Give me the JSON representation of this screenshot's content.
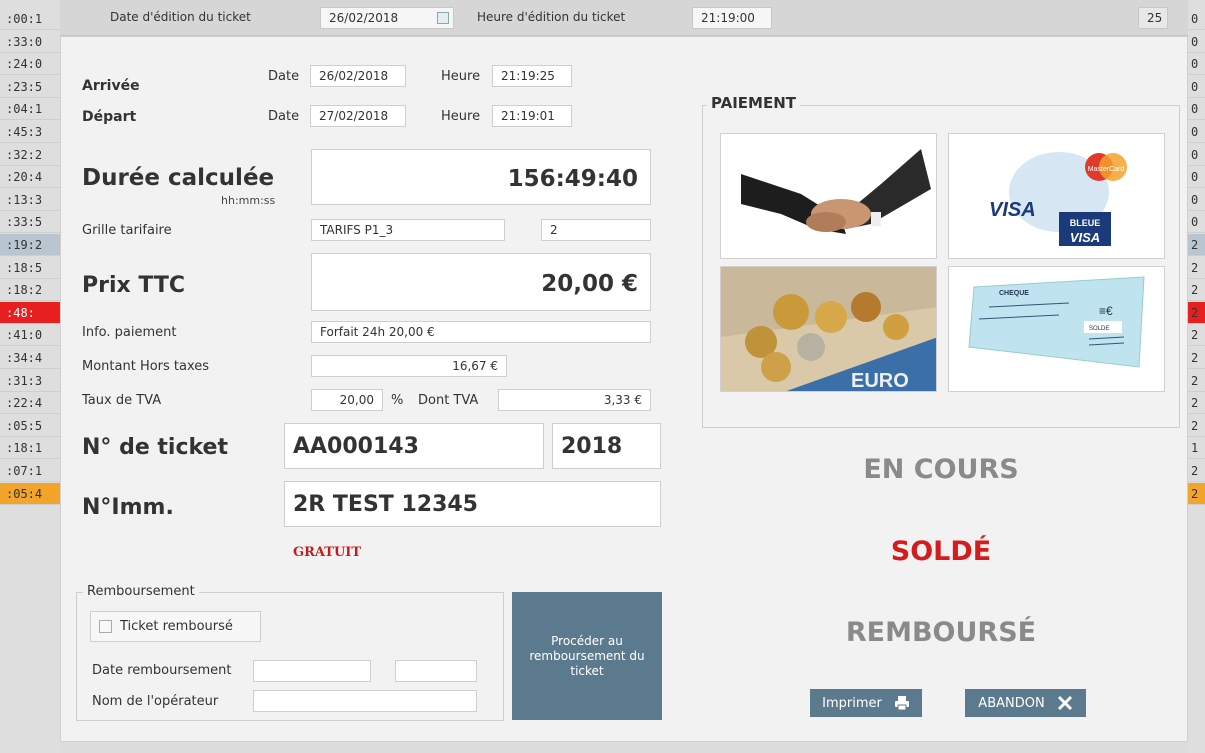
{
  "topbar": {
    "date_label": "Date d'édition du ticket",
    "date_value": "26/02/2018",
    "time_label": "Heure d'édition du ticket",
    "time_value": "21:19:00",
    "right_value": "25"
  },
  "background": {
    "left_times": [
      ":00:1",
      ":33:0",
      ":24:0",
      ":23:5",
      ":04:1",
      ":45:3",
      ":32:2",
      ":20:4",
      ":13:3",
      ":33:5",
      ":19:2",
      ":18:5",
      ":18:2",
      ":48:",
      ":41:0",
      ":34:4",
      ":31:3",
      ":22:4",
      ":05:5",
      ":18:1",
      ":07:1",
      ":05:4"
    ],
    "right_vals": [
      "0",
      "0",
      "0",
      "0",
      "0",
      "0",
      "0",
      "0",
      "0",
      "0",
      "2",
      "2",
      "2",
      "2",
      "2",
      "2",
      "2",
      "2",
      "2",
      "1",
      "2",
      "2"
    ]
  },
  "dialog": {
    "arrivee": {
      "label": "Arrivée",
      "date_label": "Date",
      "date": "26/02/2018",
      "heure_label": "Heure",
      "heure": "21:19:25"
    },
    "depart": {
      "label": "Départ",
      "date_label": "Date",
      "date": "27/02/2018",
      "heure_label": "Heure",
      "heure": "21:19:01"
    },
    "duree": {
      "label": "Durée calculée",
      "unit": "hh:mm:ss",
      "value": "156:49:40"
    },
    "grille": {
      "label": "Grille tarifaire",
      "value": "TARIFS P1_3",
      "num": "2"
    },
    "prix": {
      "label": "Prix TTC",
      "value": "20,00 €"
    },
    "info_paiement": {
      "label": "Info. paiement",
      "value": "Forfait 24h 20,00 €"
    },
    "montant_ht": {
      "label": "Montant Hors taxes",
      "value": "16,67 €"
    },
    "tva": {
      "label": "Taux de TVA",
      "rate": "20,00",
      "pct": "%",
      "dont_label": "Dont TVA",
      "dont_value": "3,33 €"
    },
    "ticket": {
      "label": "N° de ticket",
      "value": "AA000143",
      "year": "2018"
    },
    "immat": {
      "label": "N°Imm.",
      "value": "2R TEST 12345"
    },
    "gratuit": "GRATUIT",
    "remboursement": {
      "legend": "Remboursement",
      "checkbox_label": "Ticket remboursé",
      "date_label": "Date remboursement",
      "operateur_label": "Nom de l'opérateur",
      "button": "Procéder au remboursement du ticket"
    },
    "paiement": {
      "legend": "PAIEMENT",
      "options": [
        "handshake",
        "credit-card",
        "cash",
        "cheque"
      ],
      "card_text": {
        "mastercard": "MasterCard",
        "visa": "VISA",
        "bleue": "BLEUE",
        "visa2": "VISA"
      },
      "cheque_text": {
        "title": "CHEQUE",
        "solde": "SOLDE"
      },
      "euro_text": "EURO"
    },
    "status": {
      "en_cours": "EN COURS",
      "solde": "SOLDÉ",
      "rembourse": "REMBOURSÉ"
    },
    "colors": {
      "solde": "#d51b1b",
      "muted": "#8a8a8a",
      "button": "#5c7a8e",
      "gratuit": "#c21d1d"
    },
    "buttons": {
      "imprimer": "Imprimer",
      "abandon": "ABANDON"
    }
  }
}
